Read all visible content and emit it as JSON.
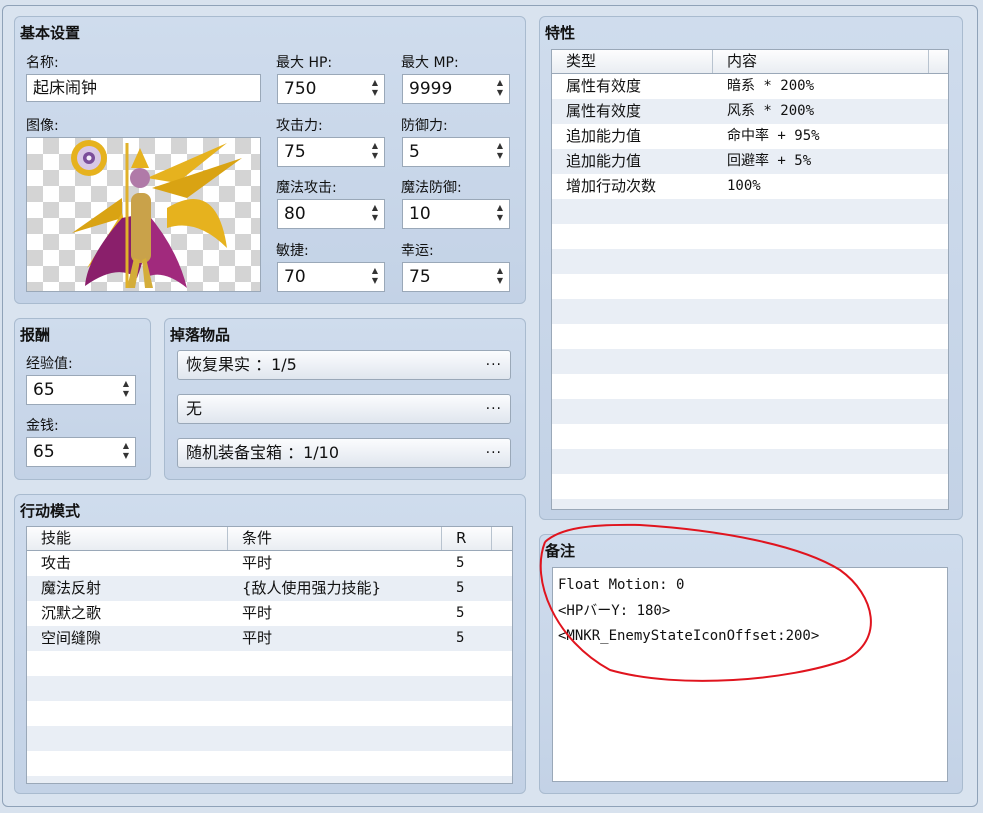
{
  "basic": {
    "title": "基本设置",
    "name_label": "名称:",
    "name_value": "起床闹钟",
    "image_label": "图像:",
    "stats": [
      {
        "label": "最大 HP:",
        "value": "750"
      },
      {
        "label": "最大 MP:",
        "value": "9999"
      },
      {
        "label": "攻击力:",
        "value": "75"
      },
      {
        "label": "防御力:",
        "value": "5"
      },
      {
        "label": "魔法攻击:",
        "value": "80"
      },
      {
        "label": "魔法防御:",
        "value": "10"
      },
      {
        "label": "敏捷:",
        "value": "70"
      },
      {
        "label": "幸运:",
        "value": "75"
      }
    ]
  },
  "reward": {
    "title": "报酬",
    "exp_label": "经验值:",
    "exp_value": "65",
    "gold_label": "金钱:",
    "gold_value": "65"
  },
  "drops": {
    "title": "掉落物品",
    "items": [
      "恢复果实 ：1/5",
      "无",
      "随机装备宝箱 ：1/10"
    ],
    "more_label": "···"
  },
  "actions": {
    "title": "行动模式",
    "columns": [
      "技能",
      "条件",
      "R"
    ],
    "rows": [
      {
        "skill": "攻击",
        "condition": "平时",
        "r": "5"
      },
      {
        "skill": "魔法反射",
        "condition": "{敌人使用强力技能}",
        "r": "5"
      },
      {
        "skill": "沉默之歌",
        "condition": "平时",
        "r": "5"
      },
      {
        "skill": "空间缝隙",
        "condition": "平时",
        "r": "5"
      }
    ]
  },
  "traits": {
    "title": "特性",
    "columns": [
      "类型",
      "内容"
    ],
    "rows": [
      {
        "type": "属性有效度",
        "content": "暗系 * 200%"
      },
      {
        "type": "属性有效度",
        "content": "风系 * 200%"
      },
      {
        "type": "追加能力值",
        "content": "命中率 + 95%"
      },
      {
        "type": "追加能力值",
        "content": "回避率 + 5%"
      },
      {
        "type": "增加行动次数",
        "content": "100%"
      }
    ]
  },
  "note": {
    "title": "备注",
    "lines": [
      "Float Motion: 0",
      "<HPバーY: 180>",
      "<MNKR_EnemyStateIconOffset:200>"
    ]
  },
  "icons": {
    "spin": "spin-arrows-icon",
    "sprite": "enemy-sprite",
    "more": "ellipsis-icon"
  },
  "colors": {
    "annotation": "#e0141e",
    "panel": "#c6d4e7",
    "row_alt": "#e9eef5"
  }
}
